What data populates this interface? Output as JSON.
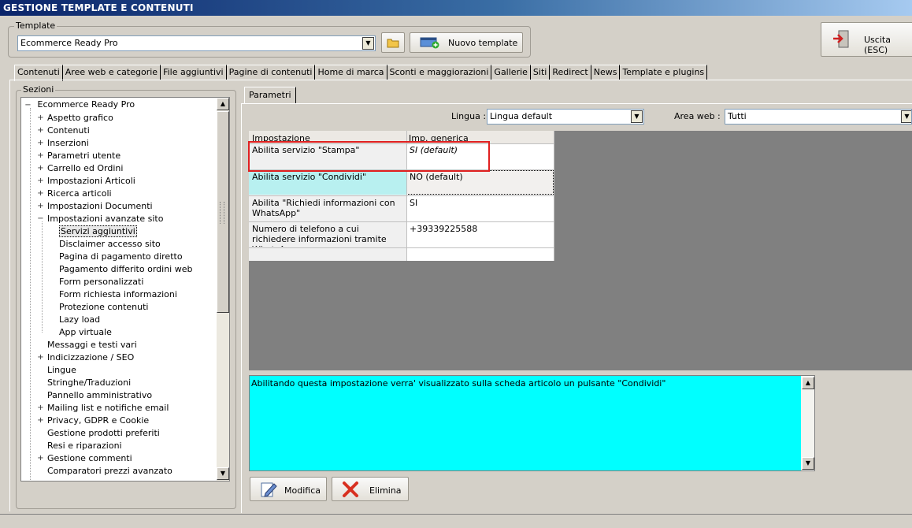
{
  "window": {
    "title": "GESTIONE TEMPLATE E CONTENUTI"
  },
  "template_group": {
    "label": "Template",
    "selected": "Ecommerce Ready Pro",
    "new_button": "Nuovo template"
  },
  "exit_button": "Uscita (ESC)",
  "tabs": [
    "Contenuti",
    "Aree web e categorie",
    "File aggiuntivi",
    "Pagine di contenuti",
    "Home di marca",
    "Sconti e maggiorazioni",
    "Gallerie",
    "Siti",
    "Redirect",
    "News",
    "Template e plugins"
  ],
  "sections": {
    "label": "Sezioni",
    "root": "Ecommerce Ready Pro",
    "items": [
      "Aspetto grafico",
      "Contenuti",
      "Inserzioni",
      "Parametri utente",
      "Carrello ed Ordini",
      "Impostazioni Articoli",
      "Ricerca articoli",
      "Impostazioni Documenti",
      "Impostazioni avanzate sito",
      "Servizi aggiuntivi",
      "Disclaimer accesso sito",
      "Pagina di pagamento diretto",
      "Pagamento differito ordini web",
      "Form personalizzati",
      "Form richiesta informazioni",
      "Protezione contenuti",
      "Lazy load",
      "App virtuale",
      "Messaggi e testi vari",
      "Indicizzazione / SEO",
      "Lingue",
      "Stringhe/Traduzioni",
      "Pannello amministrativo",
      "Mailing list e notifiche email",
      "Privacy, GDPR e Cookie",
      "Gestione prodotti preferiti",
      "Resi e riparazioni",
      "Gestione commenti",
      "Comparatori prezzi avanzato"
    ]
  },
  "params_tab": "Parametri",
  "filters": {
    "lingua_label": "Lingua :",
    "lingua_value": "Lingua default",
    "area_label": "Area web :",
    "area_value": "Tutti"
  },
  "grid": {
    "headers": [
      "Impostazione",
      "Imp. generica"
    ],
    "rows": [
      {
        "setting": "Abilita servizio \"Stampa\"",
        "value": "SI (default)"
      },
      {
        "setting": "Abilita servizio \"Condividi\"",
        "value": "NO (default)"
      },
      {
        "setting": "Abilita \"Richiedi informazioni con WhatsApp\"",
        "value": "SI"
      },
      {
        "setting": "Numero di telefono a cui richiedere informazioni tramite WhatsApp",
        "value": "+39339225588"
      }
    ]
  },
  "description": "Abilitando questa impostazione verra' visualizzato sulla scheda articolo un pulsante \"Condividi\"",
  "buttons": {
    "modifica": "Modifica",
    "elimina": "Elimina"
  },
  "colors": {
    "highlight_row": "#b8f0f0",
    "description_bg": "#00ffff",
    "grid_area": "#808080",
    "annotation": "#e02020"
  }
}
